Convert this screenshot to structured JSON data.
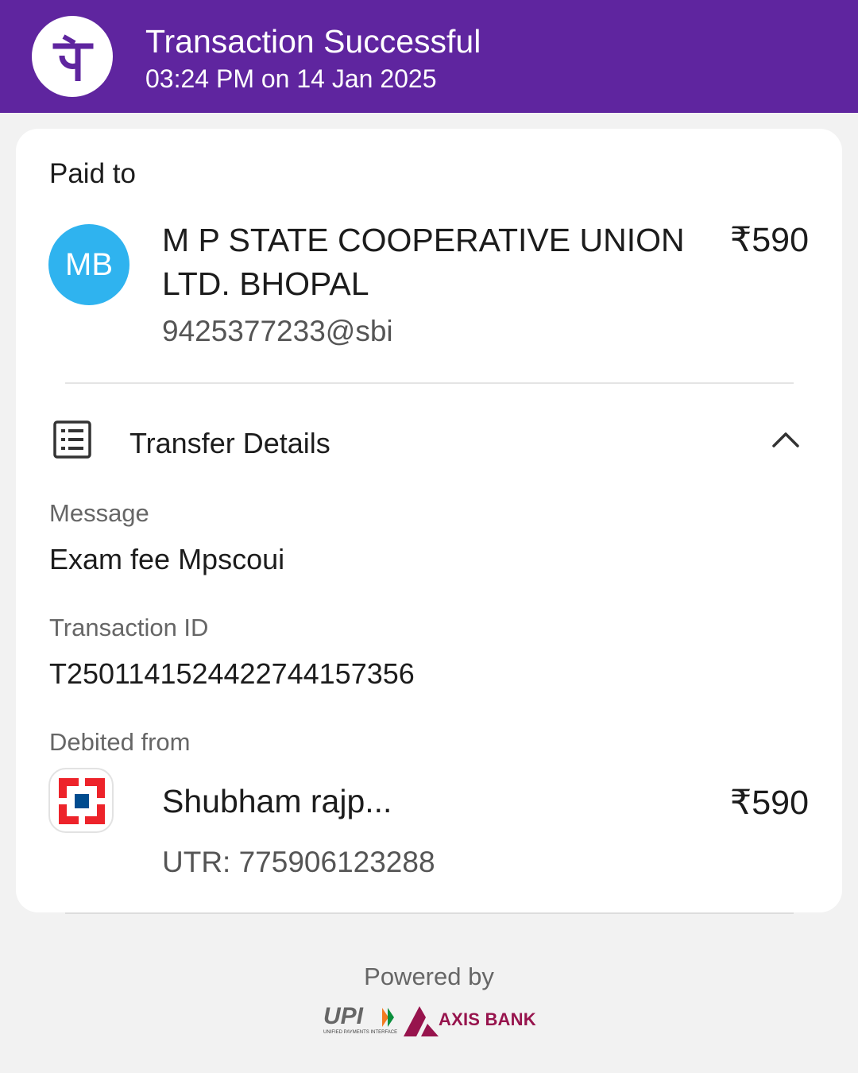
{
  "header": {
    "logo_icon": "phonepe-logo",
    "title": "Transaction Successful",
    "datetime": "03:24 PM on 14 Jan 2025",
    "bg_color": "#5f259f"
  },
  "paid_to": {
    "label": "Paid to",
    "avatar_initials": "MB",
    "avatar_color": "#2fb3ef",
    "name": "M P STATE COOPERATIVE UNION LTD. BHOPAL",
    "upi_id": "9425377233@sbi",
    "amount": "₹590"
  },
  "transfer_details": {
    "icon": "document-list-icon",
    "label": "Transfer Details",
    "toggle_icon": "chevron-up-icon",
    "message_label": "Message",
    "message_value": "Exam fee Mpscoui",
    "txn_id_label": "Transaction ID",
    "txn_id_value": "T2501141524422744157356",
    "debited_label": "Debited from",
    "bank_icon": "hdfc-bank-logo",
    "account_name": "Shubham rajp...",
    "account_amount": "₹590",
    "utr": "UTR: 775906123288"
  },
  "footer": {
    "powered_by": "Powered by",
    "upi_logo_text": "UPI",
    "upi_logo_subtext": "UNIFIED PAYMENTS INTERFACE",
    "bank_partner": "AXIS BANK"
  }
}
